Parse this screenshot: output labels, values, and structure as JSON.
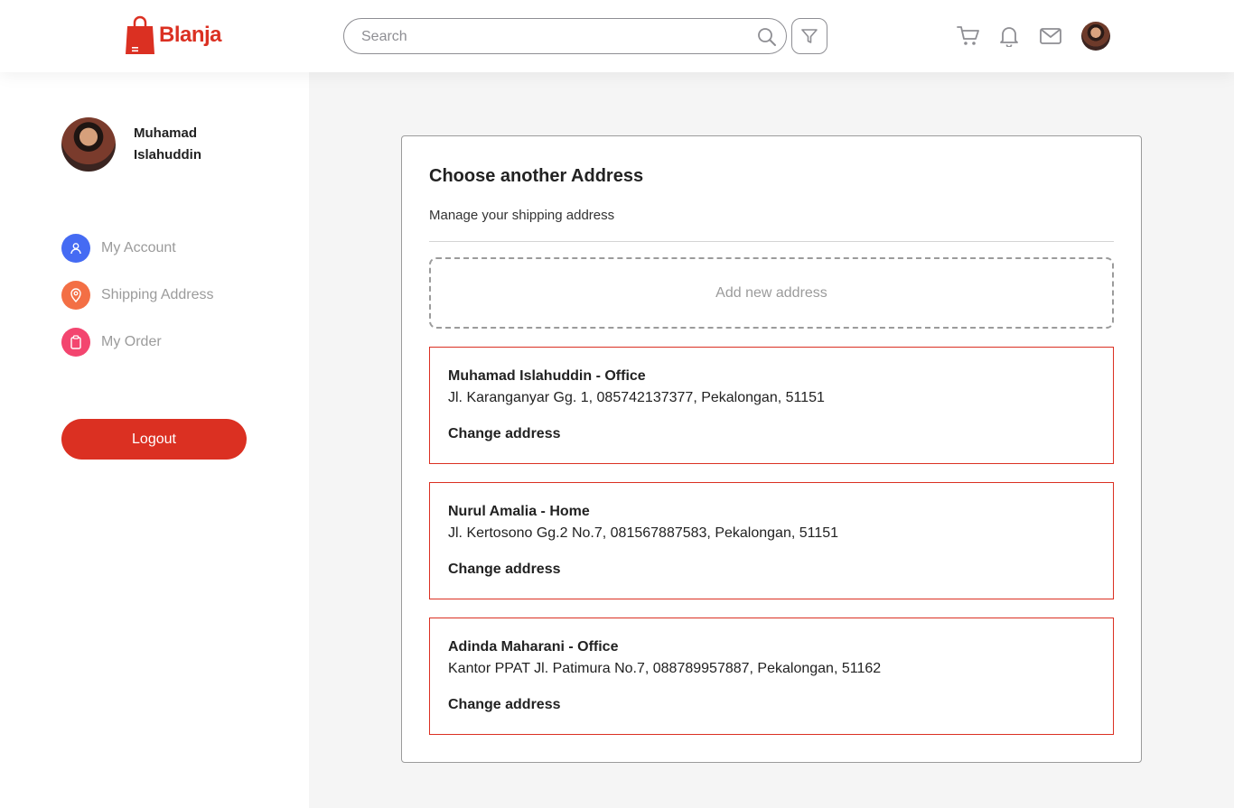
{
  "header": {
    "brand": "Blanja",
    "brand_color": "#db3022",
    "search": {
      "placeholder": "Search",
      "value": ""
    },
    "icons": [
      "search-icon",
      "filter-icon",
      "cart-icon",
      "bell-icon",
      "mail-icon",
      "avatar"
    ]
  },
  "sidebar": {
    "user_name_first": "Muhamad",
    "user_name_last": "Islahuddin",
    "items": [
      {
        "label": "My Account",
        "icon": "user-icon",
        "color": "#456bf3"
      },
      {
        "label": "Shipping Address",
        "icon": "map-pin-icon",
        "color": "#f36f45"
      },
      {
        "label": "My Order",
        "icon": "clipboard-icon",
        "color": "#f3456f"
      }
    ],
    "logout_label": "Logout"
  },
  "main": {
    "title": "Choose another Address",
    "subtitle": "Manage your shipping address",
    "add_label": "Add new address",
    "addresses": [
      {
        "name": "Muhamad Islahuddin - Office",
        "detail": "Jl. Karanganyar Gg. 1, 085742137377, Pekalongan, 51151",
        "action": "Change address"
      },
      {
        "name": "Nurul Amalia - Home",
        "detail": "Jl. Kertosono Gg.2 No.7, 081567887583, Pekalongan, 51151",
        "action": "Change address"
      },
      {
        "name": "Adinda Maharani - Office",
        "detail": "Kantor PPAT Jl. Patimura No.7, 088789957887, Pekalongan, 51162",
        "action": "Change address"
      }
    ]
  }
}
